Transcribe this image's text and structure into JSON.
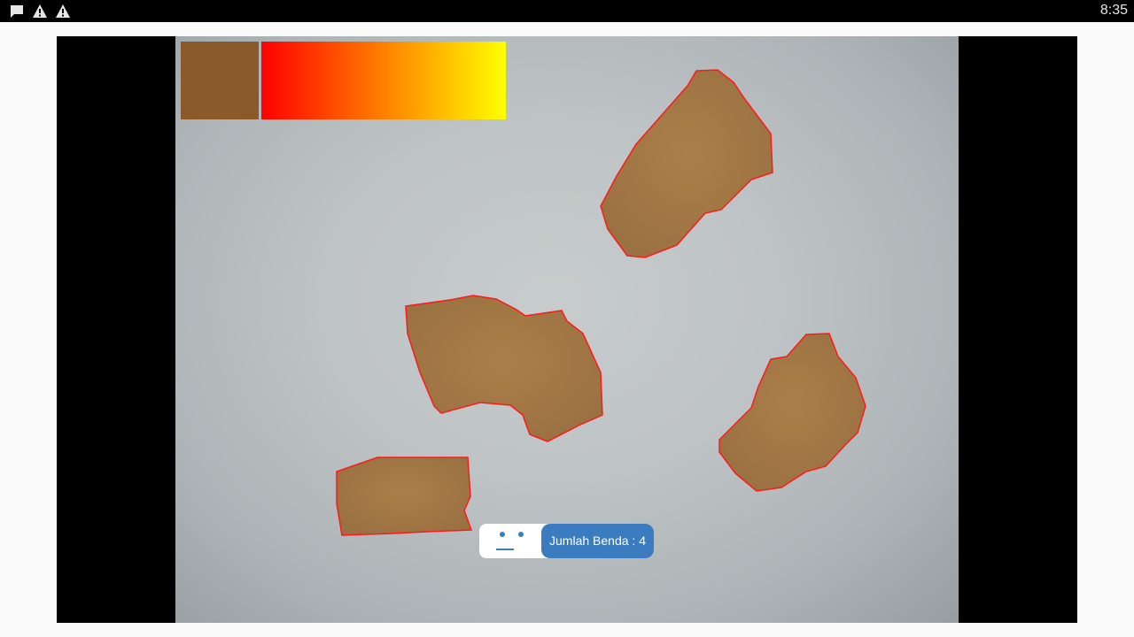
{
  "status_bar": {
    "icons": [
      "notification-chat-icon",
      "warning-icon",
      "warning-icon"
    ],
    "time": "8:35"
  },
  "overlay": {
    "detected_color": "#8a5a2b",
    "hue_range": {
      "start": "#ff0000",
      "end": "#ffff00"
    }
  },
  "counter": {
    "face_icon": "neutral-face-icon",
    "label": "Jumlah Benda : 4"
  },
  "colors": {
    "contour": "#ff1a1a",
    "object_fill": "#a47a45",
    "background_paper": "#bec3c5",
    "accent": "#3b7bbf"
  }
}
